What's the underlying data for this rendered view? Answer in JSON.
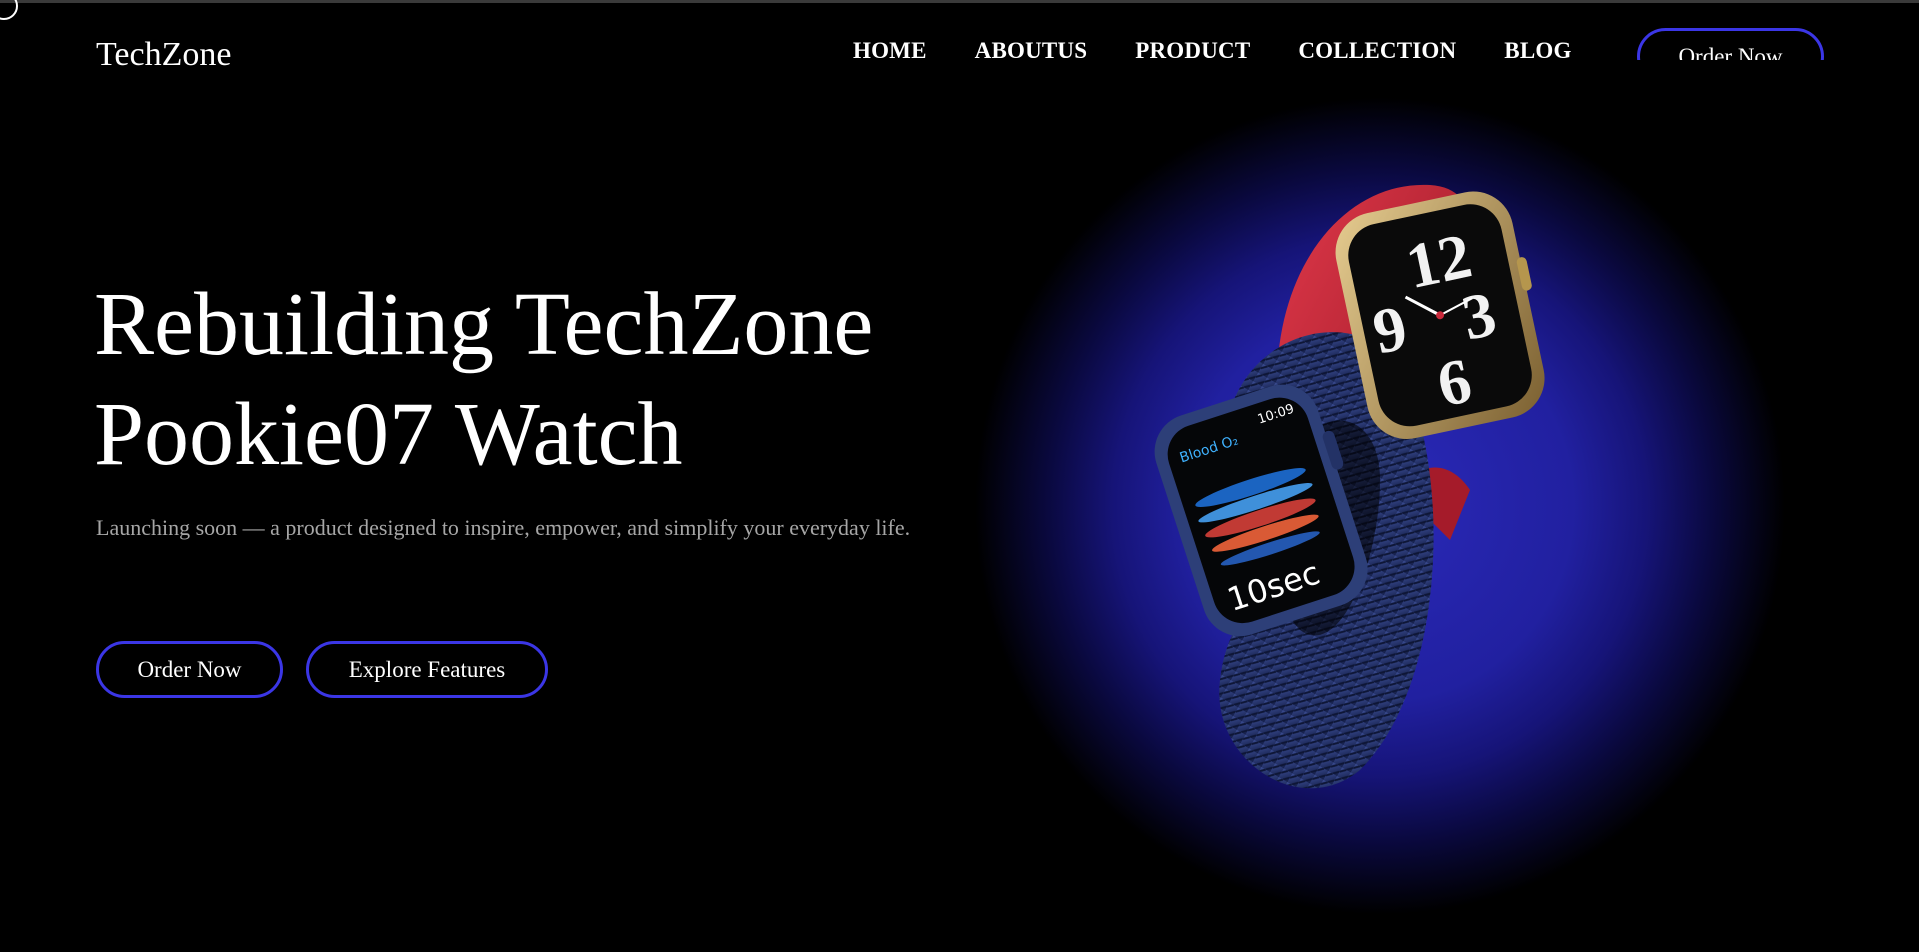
{
  "header": {
    "brand": "TechZone",
    "nav": [
      {
        "label": "HOME"
      },
      {
        "label": "ABOUTUS"
      },
      {
        "label": "PRODUCT"
      },
      {
        "label": "COLLECTION"
      },
      {
        "label": "BLOG"
      }
    ],
    "cta_label": "Order Now"
  },
  "hero": {
    "title_line1": "Rebuilding TechZone",
    "title_line2": "Pookie07 Watch",
    "subtitle": "Launching soon — a product designed to inspire, empower, and simplify your everyday life.",
    "primary_button": "Order Now",
    "secondary_button": "Explore Features"
  },
  "watch": {
    "front_time": "10:09",
    "front_app": "Blood O₂",
    "front_countdown": "10sec",
    "back_face_numerals": [
      "12",
      "9",
      "6",
      "3"
    ]
  },
  "colors": {
    "accent": "#3b36e6",
    "background": "#000000",
    "glow": "#2120a0",
    "band_red": "#c8283a",
    "band_blue": "#2a3a78",
    "case_gold": "#c9a86a"
  }
}
